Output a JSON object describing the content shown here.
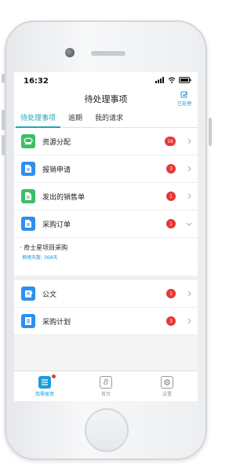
{
  "status": {
    "time": "16:32"
  },
  "nav": {
    "title": "待处理事项",
    "done_label": "已处理"
  },
  "tabs": [
    {
      "label": "待处理事项",
      "active": true
    },
    {
      "label": "逾期",
      "active": false
    },
    {
      "label": "我的请求",
      "active": false
    }
  ],
  "items": [
    {
      "label": "资源分配",
      "count": "16",
      "color": "#3cbf68",
      "icon": "resource-icon"
    },
    {
      "label": "报销申请",
      "count": "3",
      "color": "#2f8ff0",
      "icon": "reimburse-icon"
    },
    {
      "label": "发出的销售单",
      "count": "1",
      "color": "#3cbf68",
      "icon": "sales-order-icon"
    },
    {
      "label": "采购订单",
      "count": "1",
      "color": "#2f8ff0",
      "icon": "purchase-order-icon",
      "expanded": true
    },
    {
      "label": "公文",
      "count": "1",
      "color": "#2f8ff0",
      "icon": "document-icon"
    },
    {
      "label": "采购计划",
      "count": "3",
      "color": "#2f8ff0",
      "icon": "purchase-plan-icon"
    }
  ],
  "expanded_sub": {
    "title": "· 奇士星项目采购",
    "detail": "拥堵天数: 368天"
  },
  "tabbar": [
    {
      "label": "我需留意",
      "icon": "list-icon",
      "active": true
    },
    {
      "label": "首页",
      "icon": "home-8-icon",
      "active": false
    },
    {
      "label": "设置",
      "icon": "settings-icon",
      "active": false
    }
  ],
  "colors": {
    "accent": "#1fa8b4",
    "badge": "#e53935",
    "link": "#1a9ddd"
  }
}
